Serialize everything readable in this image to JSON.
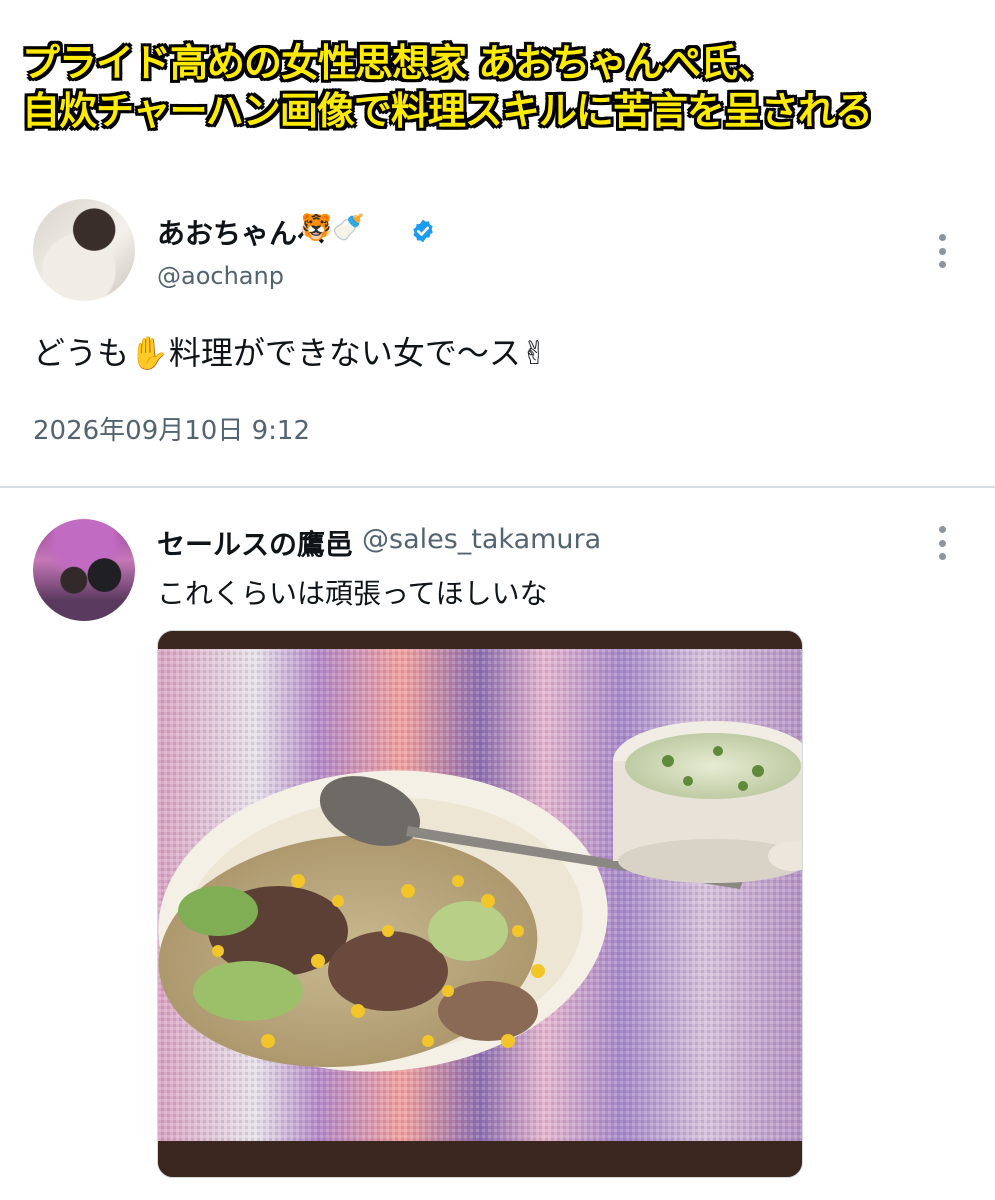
{
  "headline": {
    "line1": "プライド高めの女性思想家 あおちゃんぺ氏、",
    "line2": "自炊チャーハン画像で料理スキルに苦言を呈される"
  },
  "main_tweet": {
    "display_name": "あおちゃんぺ",
    "name_emojis": [
      "🐯",
      "🍼"
    ],
    "handle": "@aochanp",
    "verified": true,
    "text": "どうも✋料理ができない女で〜ス✌",
    "timestamp": "2026年09月10日 9:12"
  },
  "reply_tweet": {
    "display_name": "セールスの鷹邑",
    "handle": "@sales_takamura",
    "text": "これくらいは頑張ってほしいな",
    "image_subject": "fried rice with meat, cabbage and corn, soup cup, spoon on striped placemat"
  },
  "colors": {
    "headline_fill": "#ffeb00",
    "headline_stroke": "#000000",
    "verified_blue": "#1d9bf0",
    "secondary_text": "#536471"
  }
}
